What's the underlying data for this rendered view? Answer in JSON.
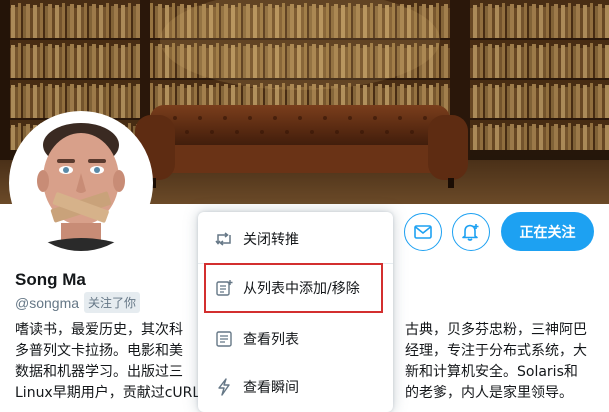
{
  "profile": {
    "name": "Song Ma",
    "handle": "@songma",
    "follows_you": "关注了你",
    "bio_lines": [
      "嗜读书，最爱历史，其次科",
      "古典，贝多芬忠粉，三神阿巴",
      "多普列文卡拉扬。电影和美",
      "经理，专注于分布式系统，大",
      "数据和机器学习。出版过三",
      "新和计算机安全。Solaris和",
      "Linux早期用户，贡献过cURL",
      "的老爹，内人是家里领导。"
    ]
  },
  "actions": {
    "follow_label": "正在关注",
    "mail_icon": "mail-icon",
    "notify_icon": "bell-plus-icon"
  },
  "menu": {
    "items": [
      {
        "label": "关闭转推",
        "icon": "retweet-icon"
      },
      {
        "label": "从列表中添加/移除",
        "icon": "list-add-icon"
      },
      {
        "label": "查看列表",
        "icon": "list-icon"
      },
      {
        "label": "查看瞬间",
        "icon": "lightning-icon"
      }
    ]
  },
  "colors": {
    "accent": "#1da1f2",
    "highlight_border": "#d32f2f",
    "text_muted": "#657786"
  }
}
